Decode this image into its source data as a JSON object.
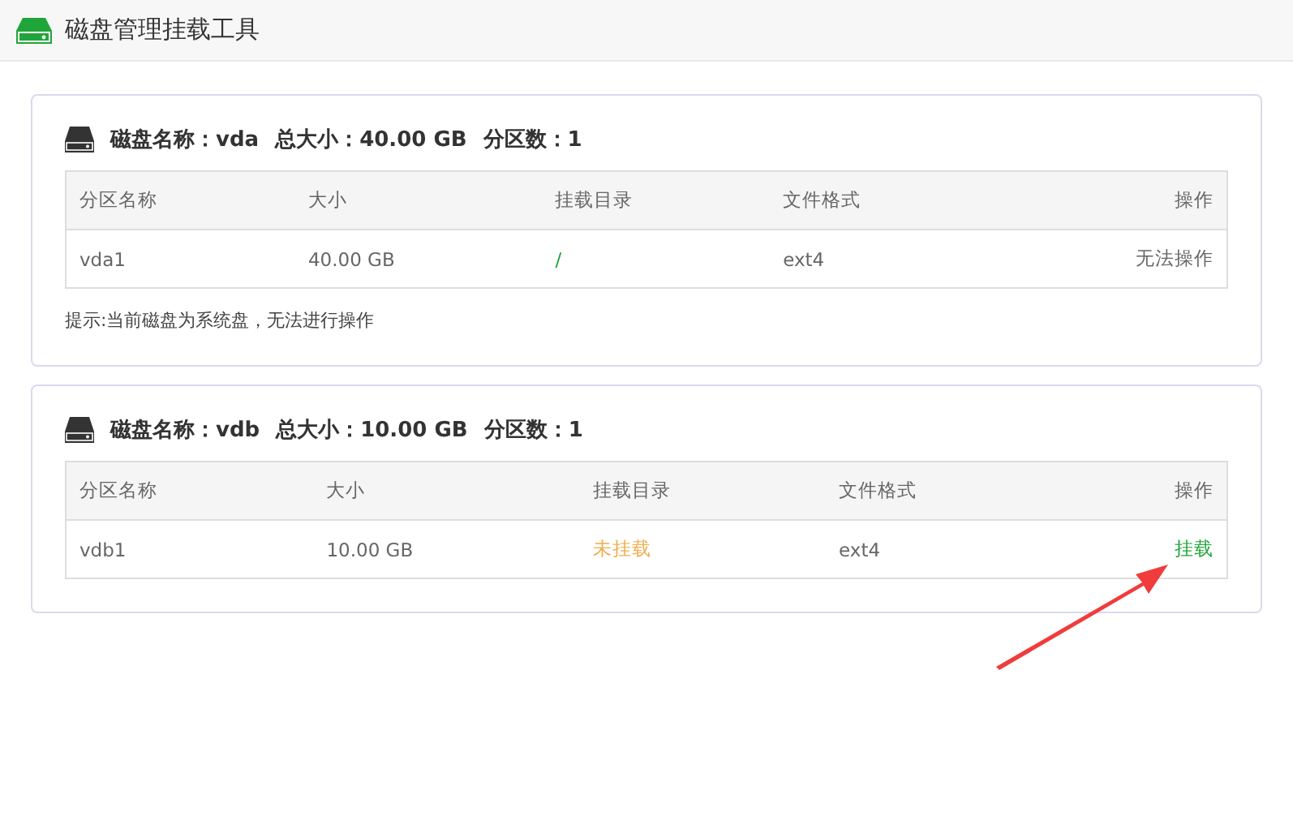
{
  "window": {
    "title": "磁盘管理挂载工具"
  },
  "disks": [
    {
      "header": [
        "磁盘名称：vda",
        "总大小：40.00 GB",
        "分区数：1"
      ],
      "columns": [
        "分区名称",
        "大小",
        "挂载目录",
        "文件格式",
        "操作"
      ],
      "rows": [
        {
          "name": "vda1",
          "size": "40.00 GB",
          "mount": {
            "text": "/",
            "kind": "mounted"
          },
          "format": "ext4",
          "action": {
            "text": "无法操作",
            "kind": "disabled"
          }
        }
      ],
      "hint": "提示:当前磁盘为系统盘，无法进行操作"
    },
    {
      "header": [
        "磁盘名称：vdb",
        "总大小：10.00 GB",
        "分区数：1"
      ],
      "columns": [
        "分区名称",
        "大小",
        "挂载目录",
        "文件格式",
        "操作"
      ],
      "rows": [
        {
          "name": "vdb1",
          "size": "10.00 GB",
          "mount": {
            "text": "未挂载",
            "kind": "unmounted"
          },
          "format": "ext4",
          "action": {
            "text": "挂载",
            "kind": "link"
          }
        }
      ]
    }
  ]
}
